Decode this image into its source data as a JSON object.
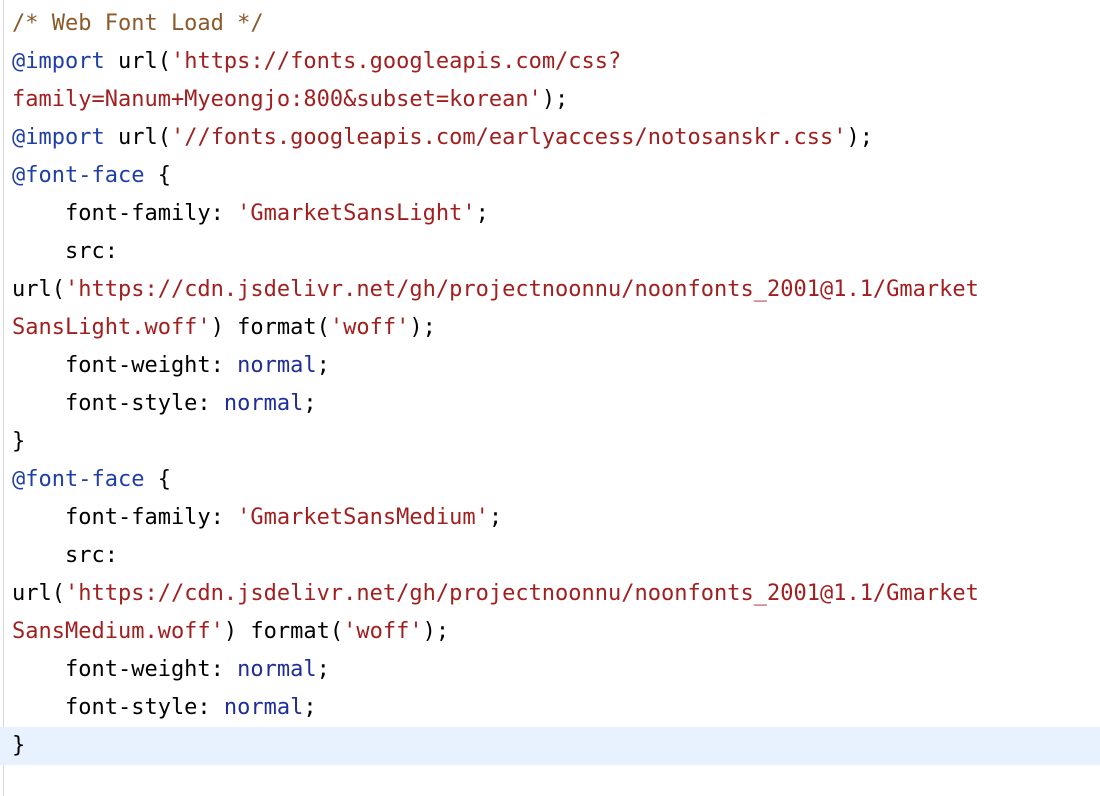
{
  "editor": {
    "lines": [
      {
        "current": false,
        "tokens": [
          {
            "t": "/* Web Font Load */",
            "c": "comment"
          }
        ]
      },
      {
        "current": false,
        "tokens": [
          {
            "t": "@import",
            "c": "at"
          },
          {
            "t": " url(",
            "c": "plain"
          },
          {
            "t": "'https://fonts.googleapis.com/css?",
            "c": "str"
          }
        ]
      },
      {
        "current": false,
        "tokens": [
          {
            "t": "family=Nanum+Myeongjo:800&subset=korean'",
            "c": "str"
          },
          {
            "t": ");",
            "c": "plain"
          }
        ]
      },
      {
        "current": false,
        "tokens": [
          {
            "t": "@import",
            "c": "at"
          },
          {
            "t": " url(",
            "c": "plain"
          },
          {
            "t": "'//fonts.googleapis.com/earlyaccess/notosanskr.css'",
            "c": "str"
          },
          {
            "t": ");",
            "c": "plain"
          }
        ]
      },
      {
        "current": false,
        "tokens": [
          {
            "t": "@font-face",
            "c": "at"
          },
          {
            "t": " {",
            "c": "plain"
          }
        ]
      },
      {
        "current": false,
        "tokens": [
          {
            "t": "    font-family: ",
            "c": "plain"
          },
          {
            "t": "'GmarketSansLight'",
            "c": "str"
          },
          {
            "t": ";",
            "c": "plain"
          }
        ]
      },
      {
        "current": false,
        "tokens": [
          {
            "t": "    src:",
            "c": "plain"
          }
        ]
      },
      {
        "current": false,
        "tokens": [
          {
            "t": "url(",
            "c": "plain"
          },
          {
            "t": "'https://cdn.jsdelivr.net/gh/projectnoonnu/noonfonts_2001@1.1/Gmarket",
            "c": "str"
          }
        ]
      },
      {
        "current": false,
        "tokens": [
          {
            "t": "SansLight.woff'",
            "c": "str"
          },
          {
            "t": ") format(",
            "c": "plain"
          },
          {
            "t": "'woff'",
            "c": "str"
          },
          {
            "t": ");",
            "c": "plain"
          }
        ]
      },
      {
        "current": false,
        "tokens": [
          {
            "t": "    font-weight: ",
            "c": "plain"
          },
          {
            "t": "normal",
            "c": "kw"
          },
          {
            "t": ";",
            "c": "plain"
          }
        ]
      },
      {
        "current": false,
        "tokens": [
          {
            "t": "    font-style: ",
            "c": "plain"
          },
          {
            "t": "normal",
            "c": "kw"
          },
          {
            "t": ";",
            "c": "plain"
          }
        ]
      },
      {
        "current": false,
        "tokens": [
          {
            "t": "}",
            "c": "plain"
          }
        ]
      },
      {
        "current": false,
        "tokens": [
          {
            "t": "@font-face",
            "c": "at"
          },
          {
            "t": " {",
            "c": "plain"
          }
        ]
      },
      {
        "current": false,
        "tokens": [
          {
            "t": "    font-family: ",
            "c": "plain"
          },
          {
            "t": "'GmarketSansMedium'",
            "c": "str"
          },
          {
            "t": ";",
            "c": "plain"
          }
        ]
      },
      {
        "current": false,
        "tokens": [
          {
            "t": "    src:",
            "c": "plain"
          }
        ]
      },
      {
        "current": false,
        "tokens": [
          {
            "t": "url(",
            "c": "plain"
          },
          {
            "t": "'https://cdn.jsdelivr.net/gh/projectnoonnu/noonfonts_2001@1.1/Gmarket",
            "c": "str"
          }
        ]
      },
      {
        "current": false,
        "tokens": [
          {
            "t": "SansMedium.woff'",
            "c": "str"
          },
          {
            "t": ") format(",
            "c": "plain"
          },
          {
            "t": "'woff'",
            "c": "str"
          },
          {
            "t": ");",
            "c": "plain"
          }
        ]
      },
      {
        "current": false,
        "tokens": [
          {
            "t": "    font-weight: ",
            "c": "plain"
          },
          {
            "t": "normal",
            "c": "kw"
          },
          {
            "t": ";",
            "c": "plain"
          }
        ]
      },
      {
        "current": false,
        "tokens": [
          {
            "t": "    font-style: ",
            "c": "plain"
          },
          {
            "t": "normal",
            "c": "kw"
          },
          {
            "t": ";",
            "c": "plain"
          }
        ]
      },
      {
        "current": true,
        "tokens": [
          {
            "t": "}",
            "c": "plain"
          }
        ]
      }
    ]
  }
}
